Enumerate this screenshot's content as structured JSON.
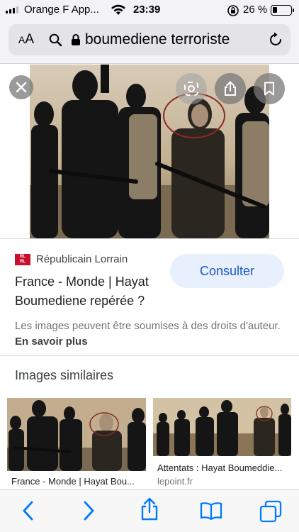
{
  "status": {
    "carrier": "Orange F App...",
    "time": "23:39",
    "battery": "26 %",
    "battery_level": 0.26
  },
  "browser": {
    "aa_label_small": "A",
    "aa_label_large": "A",
    "url": "boumediene terroriste",
    "icons": [
      "search-icon",
      "lock-icon",
      "reload-icon"
    ]
  },
  "result": {
    "source": "Républicain Lorrain",
    "source_logo": "Républicain Lorrain",
    "title": "France - Monde | Hayat Boumediene repérée ?",
    "button": "Consulter",
    "rights_text": "Les images peuvent être soumises à des droits d'auteur.",
    "rights_link": "En savoir plus"
  },
  "similar": {
    "heading": "Images similaires",
    "items": [
      {
        "caption": "France - Monde | Hayat Bou...",
        "source": ""
      },
      {
        "caption": "Attentats : Hayat Boumeddie...",
        "source": "lepoint.fr"
      }
    ]
  },
  "toolbar": {
    "icons": [
      "back-icon",
      "forward-icon",
      "share-icon",
      "bookmarks-icon",
      "tabs-icon"
    ]
  },
  "colors": {
    "accent": "#1a73e8",
    "ios_blue": "#007aff",
    "logo_red": "#c8102e"
  }
}
